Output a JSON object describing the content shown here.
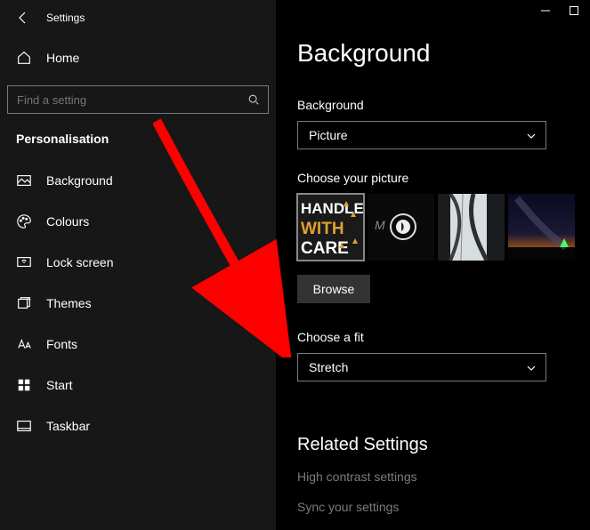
{
  "titlebar": {
    "title": "Settings"
  },
  "sidebar": {
    "home_label": "Home",
    "search_placeholder": "Find a setting",
    "section_label": "Personalisation",
    "items": [
      {
        "label": "Background"
      },
      {
        "label": "Colours"
      },
      {
        "label": "Lock screen"
      },
      {
        "label": "Themes"
      },
      {
        "label": "Fonts"
      },
      {
        "label": "Start"
      },
      {
        "label": "Taskbar"
      }
    ]
  },
  "main": {
    "page_title": "Background",
    "bg_label": "Background",
    "bg_value": "Picture",
    "choose_picture_label": "Choose your picture",
    "browse_label": "Browse",
    "fit_label": "Choose a fit",
    "fit_value": "Stretch",
    "related_head": "Related Settings",
    "related_links": [
      "High contrast settings",
      "Sync your settings"
    ]
  }
}
